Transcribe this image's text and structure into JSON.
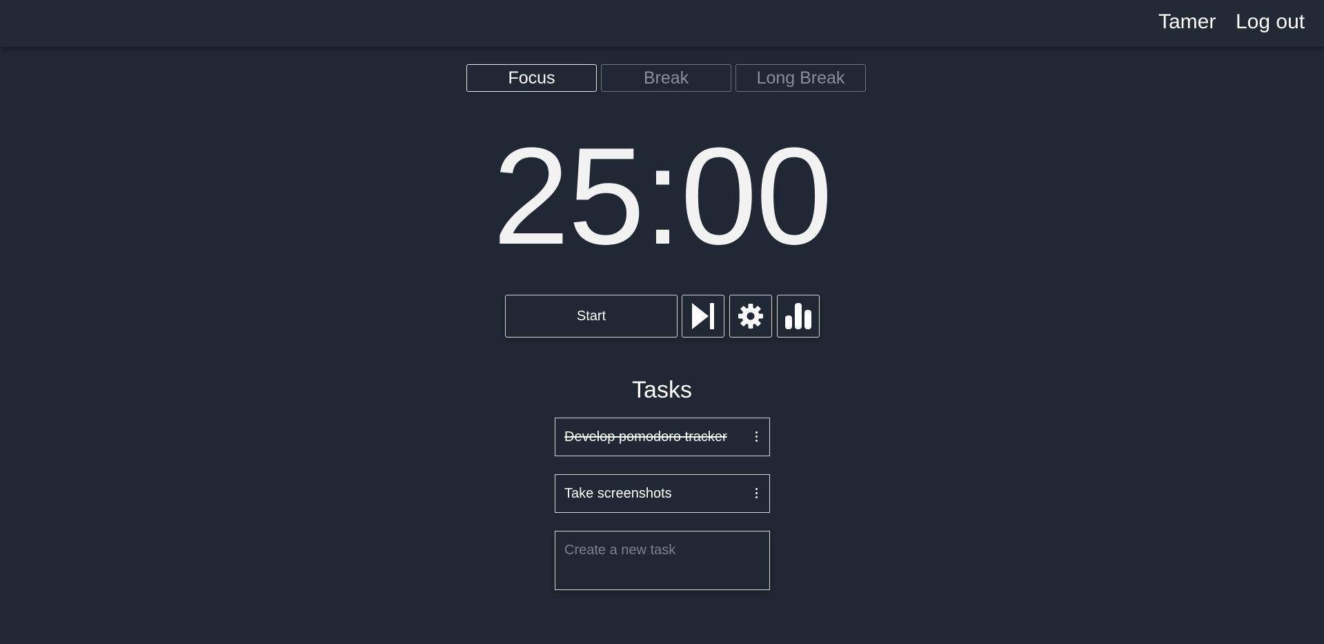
{
  "header": {
    "user_name": "Tamer",
    "logout_label": "Log out"
  },
  "modes": [
    {
      "label": "Focus",
      "active": true
    },
    {
      "label": "Break",
      "active": false
    },
    {
      "label": "Long Break",
      "active": false
    }
  ],
  "timer": {
    "display": "25:00"
  },
  "controls": {
    "start_label": "Start",
    "skip_icon": "skip-forward-icon",
    "settings_icon": "gear-icon",
    "stats_icon": "bar-chart-icon"
  },
  "tasks": {
    "heading": "Tasks",
    "items": [
      {
        "text": "Develop pomodoro tracker",
        "completed": true
      },
      {
        "text": "Take screenshots",
        "completed": false
      }
    ],
    "new_task_placeholder": "Create a new task"
  },
  "colors": {
    "background": "#222833",
    "header_background": "#232a35",
    "text": "#ffffff",
    "inactive_text": "#8a8f97"
  }
}
